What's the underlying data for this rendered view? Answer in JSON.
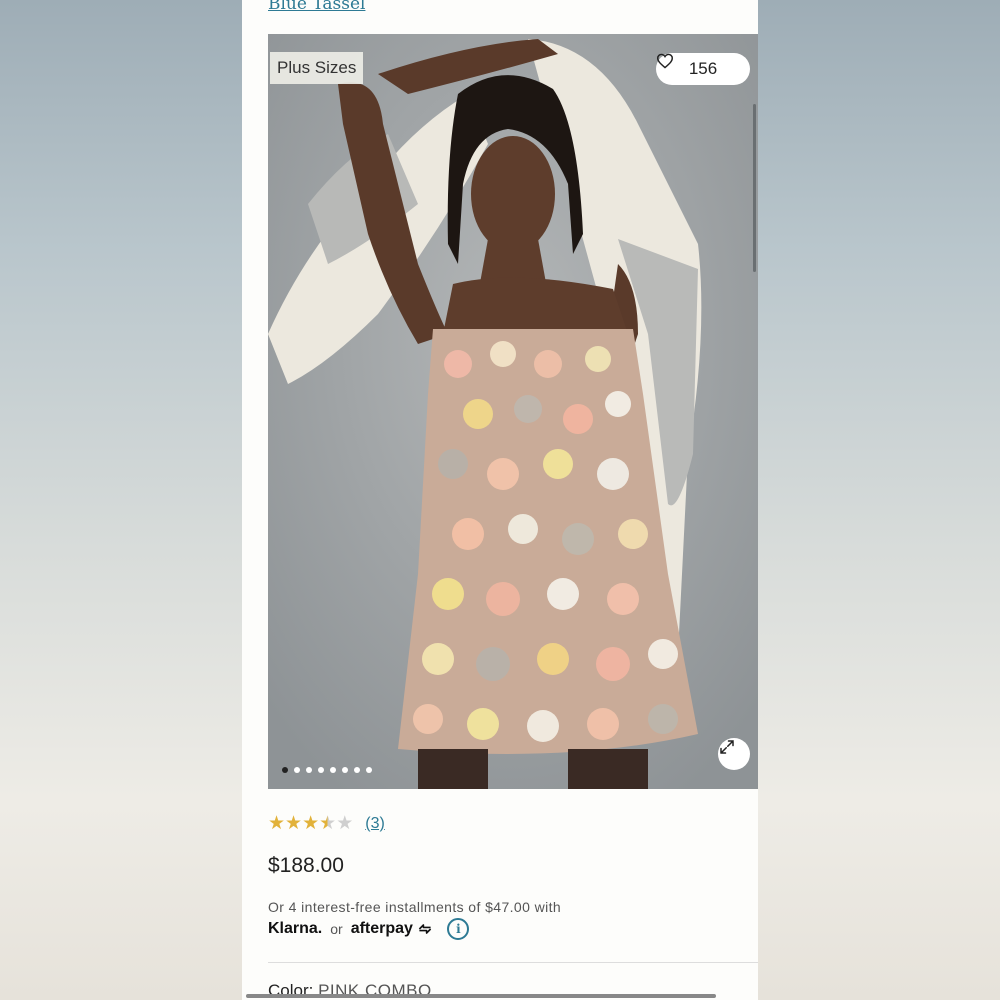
{
  "top_link": "Blue Tassel",
  "hero": {
    "tag": "Plus Sizes",
    "likes": "156",
    "image_count": 8,
    "active_index": 0
  },
  "rating": {
    "stars": 3.5,
    "count": "(3)"
  },
  "price": "$188.00",
  "installments": {
    "text": "Or 4 interest-free installments of $47.00 with",
    "klarna": "Klarna.",
    "or": "or",
    "afterpay": "afterpay"
  },
  "color": {
    "label": "Color:",
    "value": "PINK COMBO"
  },
  "colors": {
    "link": "#2d7a94",
    "star": "#e2b23a"
  }
}
